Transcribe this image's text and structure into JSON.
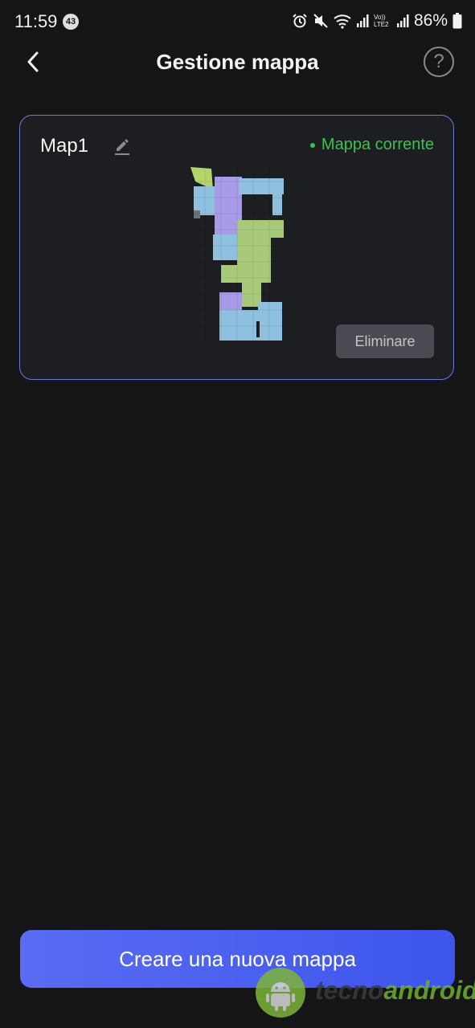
{
  "status_bar": {
    "time": "11:59",
    "notification_count": "43",
    "volte_label": "Vo)) LTE2",
    "battery": "86%"
  },
  "header": {
    "back_icon": "chevron-left-icon",
    "title": "Gestione mappa",
    "help_label": "?"
  },
  "map_card": {
    "name": "Map1",
    "edit_icon": "pencil-icon",
    "current_label": "Mappa corrente",
    "current_color": "#3fbf4f",
    "delete_label": "Eliminare",
    "room_colors": [
      "#8fc0e0",
      "#a79ae6",
      "#a8c97a",
      "#b3d46a"
    ]
  },
  "footer": {
    "create_label": "Creare una nuova mappa",
    "accent": "#4a5ff0"
  },
  "watermark": {
    "part1": "tecno",
    "part2": "android"
  }
}
